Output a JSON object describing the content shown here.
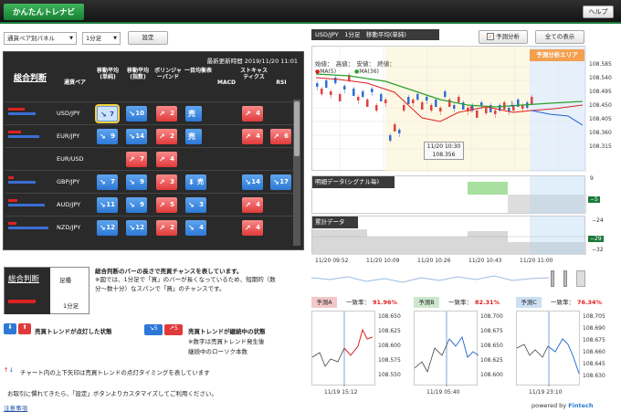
{
  "header": {
    "title": "かんたんトレナビ",
    "help": "ヘルプ"
  },
  "controls": {
    "view_select": "通貨ペア別パネル",
    "timeframe_select": "1分足",
    "settings_btn": "設定"
  },
  "matrix": {
    "updated": "最新更新時間 2019/11/20 11:01",
    "headers": [
      "総合判断",
      "通貨ペア",
      "移動平均(単純)",
      "移動平均(指数)",
      "ボリンジャーバンド",
      "一目均衡表",
      "MACD",
      "ストキャスティクス",
      "RSI"
    ],
    "rows": [
      {
        "pair": "USD/JPY",
        "cells": [
          {
            "c": "lb",
            "n": "7",
            "d": "down",
            "hl": true
          },
          {
            "c": "blue",
            "n": "10",
            "d": "down"
          },
          {
            "c": "red",
            "n": "2",
            "d": "up"
          },
          {
            "c": "blue",
            "n": "",
            "d": "sell"
          },
          null,
          {
            "c": "red",
            "n": "4",
            "d": "up"
          },
          null
        ]
      },
      {
        "pair": "EUR/JPY",
        "cells": [
          {
            "c": "blue",
            "n": "9",
            "d": "down"
          },
          {
            "c": "blue",
            "n": "14",
            "d": "down"
          },
          {
            "c": "red",
            "n": "2",
            "d": "up"
          },
          {
            "c": "blue",
            "n": "",
            "d": "sell"
          },
          null,
          {
            "c": "red",
            "n": "4",
            "d": "up"
          },
          {
            "c": "red",
            "n": "6",
            "d": "up"
          }
        ]
      },
      {
        "pair": "EUR/USD",
        "cells": [
          null,
          {
            "c": "red",
            "n": "7",
            "d": "up"
          },
          {
            "c": "red",
            "n": "4",
            "d": "up"
          },
          null,
          null,
          null,
          null
        ]
      },
      {
        "pair": "GBP/JPY",
        "cells": [
          {
            "c": "blue",
            "n": "7",
            "d": "down"
          },
          {
            "c": "blue",
            "n": "9",
            "d": "down"
          },
          {
            "c": "red",
            "n": "3",
            "d": "up"
          },
          {
            "c": "blue",
            "n": "売",
            "d": "sell2"
          },
          null,
          {
            "c": "blue",
            "n": "14",
            "d": "down"
          },
          {
            "c": "blue",
            "n": "17",
            "d": "down"
          }
        ]
      },
      {
        "pair": "AUD/JPY",
        "cells": [
          {
            "c": "blue",
            "n": "11",
            "d": "down"
          },
          {
            "c": "blue",
            "n": "9",
            "d": "down"
          },
          {
            "c": "red",
            "n": "5",
            "d": "up"
          },
          {
            "c": "blue",
            "n": "3",
            "d": "down"
          },
          null,
          {
            "c": "red",
            "n": "4",
            "d": "up"
          },
          null
        ]
      },
      {
        "pair": "NZD/JPY",
        "cells": [
          {
            "c": "blue",
            "n": "12",
            "d": "down"
          },
          {
            "c": "blue",
            "n": "12",
            "d": "down"
          },
          {
            "c": "red",
            "n": "2",
            "d": "up"
          },
          {
            "c": "blue",
            "n": "4",
            "d": "down"
          },
          null,
          {
            "c": "red",
            "n": "4",
            "d": "up"
          },
          null
        ]
      }
    ]
  },
  "legend": {
    "title": "総合判断",
    "col1": "足種",
    "tf": "1分足",
    "desc1": "総合判断のバーの長さで売買チャンスを表しています。",
    "desc2": "※図では、1分足で「買」のバーが長くなっているため、短期的（数分〜数十分）なスパンで「買」のチャンスです。",
    "lit_label": "売買トレンドが点灯した状態",
    "cont_label": "売買トレンドが継続中の状態",
    "cont_note1": "※数字は売買トレンド発生後",
    "cont_note2": "継続中のローソク本数",
    "arrow_note": "チャート内の上下矢印は売買トレンドの点灯タイミングを表しています",
    "custom_note": "お取引に慣れてきたら、「設定」ボタンよりカスタマイズしてご利用ください。",
    "notes": "注意事項"
  },
  "chart": {
    "title": "USD/JPY　1分足　移動平均(単純)",
    "forecast_toggle": "予測分析",
    "show_all": "全ての表示",
    "forecast_area": "予測分析エリア",
    "ohlc": "始値：　高値：　安値：　終値：",
    "ma1": "MA(5)",
    "ma2": "MA(36)",
    "yticks": [
      "108.585",
      "108.540",
      "108.495",
      "108.450",
      "108.405",
      "108.360",
      "108.315"
    ],
    "tooltip_time": "11/20 10:30",
    "tooltip_price": "108.356",
    "signal_label": "明細データ(シグナル毎)",
    "cum_label": "累計データ",
    "sig_ticks": [
      "9",
      "−5"
    ],
    "cum_ticks": [
      "−24",
      "−29",
      "−32"
    ],
    "xticks": [
      "11/20 09:52",
      "11/20 10:09",
      "11/20 10:26",
      "11/20 10:43",
      "11/20 11:00"
    ]
  },
  "chart_data": {
    "type": "line",
    "title": "USD/JPY 1分足 移動平均(単純)",
    "x": [
      "11/20 09:52",
      "11/20 10:09",
      "11/20 10:26",
      "11/20 10:43",
      "11/20 11:00"
    ],
    "ylim": [
      108.3,
      108.6
    ],
    "series": [
      {
        "name": "MA(5)",
        "values": [
          108.5,
          108.45,
          108.37,
          108.41,
          108.43
        ]
      },
      {
        "name": "MA(36)",
        "values": [
          108.52,
          108.49,
          108.44,
          108.42,
          108.42
        ]
      }
    ]
  },
  "predictions": [
    {
      "label": "予測A",
      "corr_label": "一致率：",
      "corr": "91.96%",
      "yticks": [
        "108.650",
        "108.625",
        "108.600",
        "108.575",
        "108.550"
      ],
      "xtick": "11/19 15:12",
      "color": "#f4c8c8"
    },
    {
      "label": "予測B",
      "corr_label": "一致率：",
      "corr": "82.31%",
      "yticks": [
        "108.700",
        "108.675",
        "108.650",
        "108.625",
        "108.600"
      ],
      "xtick": "11/19 05:40",
      "color": "#cce8cc"
    },
    {
      "label": "予測C",
      "corr_label": "一致率：",
      "corr": "76.34%",
      "yticks": [
        "108.705",
        "108.690",
        "108.675",
        "108.660",
        "108.645",
        "108.630"
      ],
      "xtick": "11/19 23:10",
      "color": "#cce0f4"
    }
  ],
  "footer": {
    "powered": "powered by",
    "brand": "Fintech"
  }
}
